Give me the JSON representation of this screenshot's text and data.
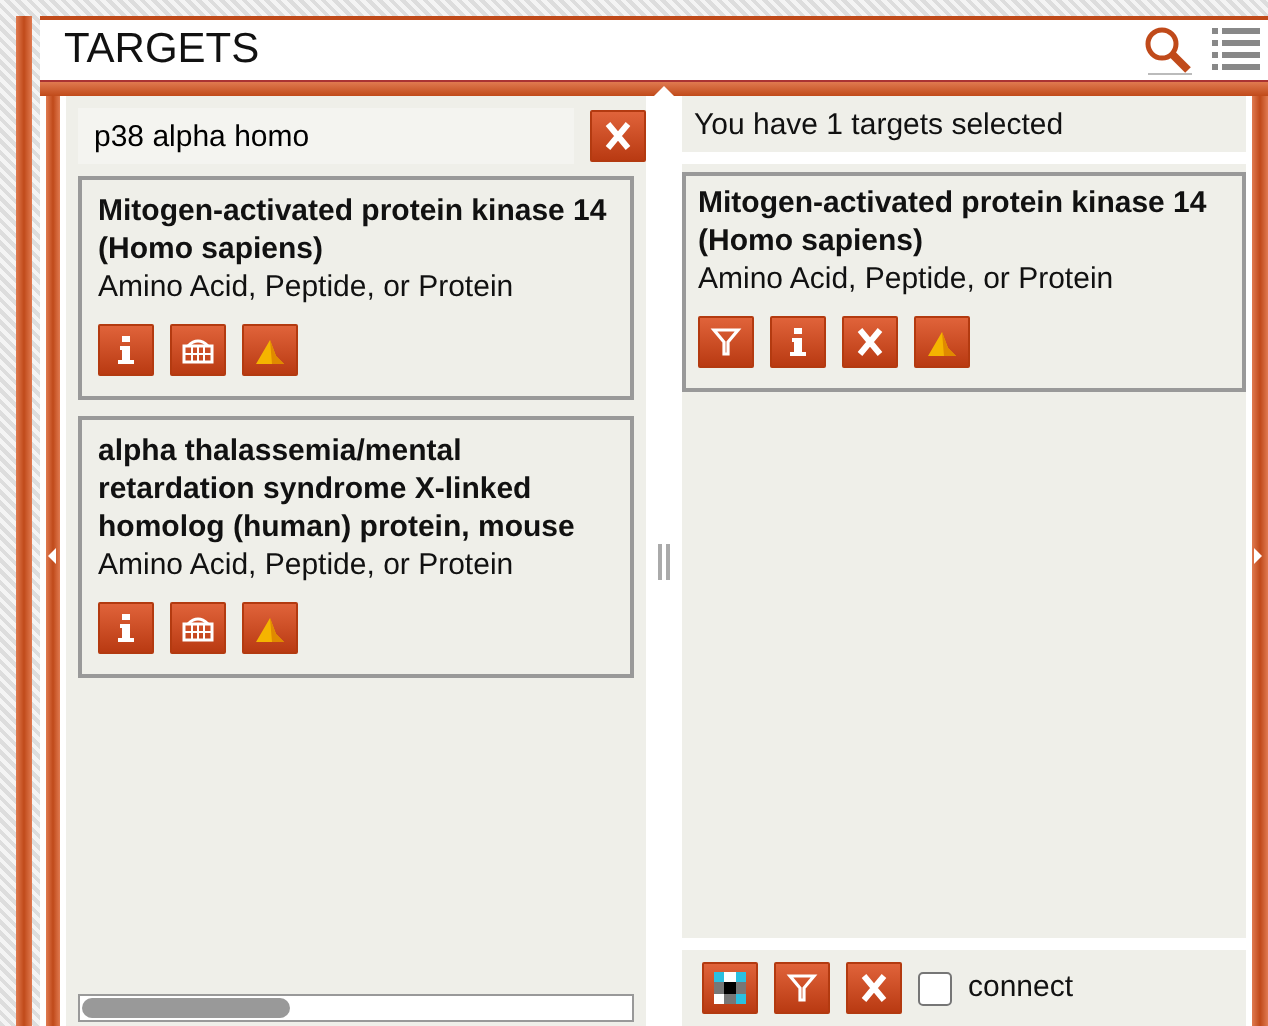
{
  "panel": {
    "title": "TARGETS"
  },
  "search": {
    "value": "p38 alpha homo"
  },
  "results": [
    {
      "title": "Mitogen-activated protein kinase 14 (Homo sapiens)",
      "type": "Amino Acid, Peptide, or Protein",
      "actions": [
        {
          "kind": "info"
        },
        {
          "kind": "grid"
        },
        {
          "kind": "chart"
        }
      ]
    },
    {
      "title": "alpha thalassemia/mental retardation syndrome X-linked homolog (human) protein, mouse",
      "type": "Amino Acid, Peptide, or Protein",
      "actions": [
        {
          "kind": "info"
        },
        {
          "kind": "grid"
        },
        {
          "kind": "chart"
        }
      ]
    }
  ],
  "selection": {
    "message": "You have 1 targets selected",
    "items": [
      {
        "title": "Mitogen-activated protein kinase 14 (Homo sapiens)",
        "type": "Amino Acid, Peptide, or Protein",
        "actions": [
          {
            "kind": "filter"
          },
          {
            "kind": "info"
          },
          {
            "kind": "remove"
          },
          {
            "kind": "chart"
          }
        ]
      }
    ],
    "toolbar": [
      {
        "kind": "matrix"
      },
      {
        "kind": "filter"
      },
      {
        "kind": "remove"
      }
    ],
    "connect": {
      "label": "connect",
      "checked": false
    }
  }
}
